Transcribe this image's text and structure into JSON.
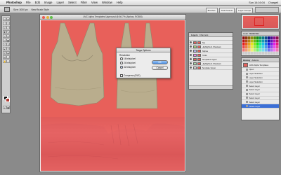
{
  "menubar": {
    "apple": "",
    "items": [
      "Photoshop",
      "File",
      "Edit",
      "Image",
      "Layer",
      "Select",
      "Filter",
      "View",
      "Window",
      "Help"
    ],
    "clock": "Sun 14:16:04",
    "user": "Chargeli"
  },
  "optionsbar": {
    "fields": [
      "Size: 3000 px",
      "New Brush Style"
    ],
    "right_buttons": [
      "Brushes",
      "Tool Presets",
      "Layer Comps"
    ]
  },
  "document": {
    "title": "LMC Alpha Templates Upper.psd @ 66.7% (Alphas, RGB/8)"
  },
  "dialog": {
    "title": "Targa Options",
    "group_label": "Resolution",
    "options": [
      "16 bits/pixel",
      "24 bits/pixel",
      "32 bits/pixel"
    ],
    "selected_index": 2,
    "compress_label": "Compress (RLE)",
    "ok_label": "OK",
    "cancel_label": "Cancel"
  },
  "layers": {
    "tabs": [
      "Layers",
      "Channels"
    ],
    "rows": [
      {
        "label": "Top",
        "color": "#e4605c"
      },
      {
        "label": "Highlights & Shadows",
        "color": "#9fcf7a"
      },
      {
        "label": "Alphas",
        "color": "#b7b7f0"
      },
      {
        "label": "Pants",
        "color": "#e882e8"
      },
      {
        "label": "Templates Upper",
        "color": "#e4605c"
      },
      {
        "label": "Highlights & Shadows",
        "color": "#a8d8a8"
      },
      {
        "label": "Template Upper",
        "color": "#cfcfcf"
      }
    ]
  },
  "swatches": {
    "tabs": [
      "Color",
      "Swatches"
    ]
  },
  "history": {
    "tabs": [
      "History",
      "Actions"
    ],
    "snapshot": "LMC Alpha Templates",
    "rows": [
      "Open",
      "Layer Selection",
      "Layer Selection",
      "Layer Selection",
      "Select Layer",
      "Select Layer",
      "Select Layer",
      "Select Layer",
      "Select Layer",
      "Delete Layer"
    ],
    "selected_index": 9
  }
}
